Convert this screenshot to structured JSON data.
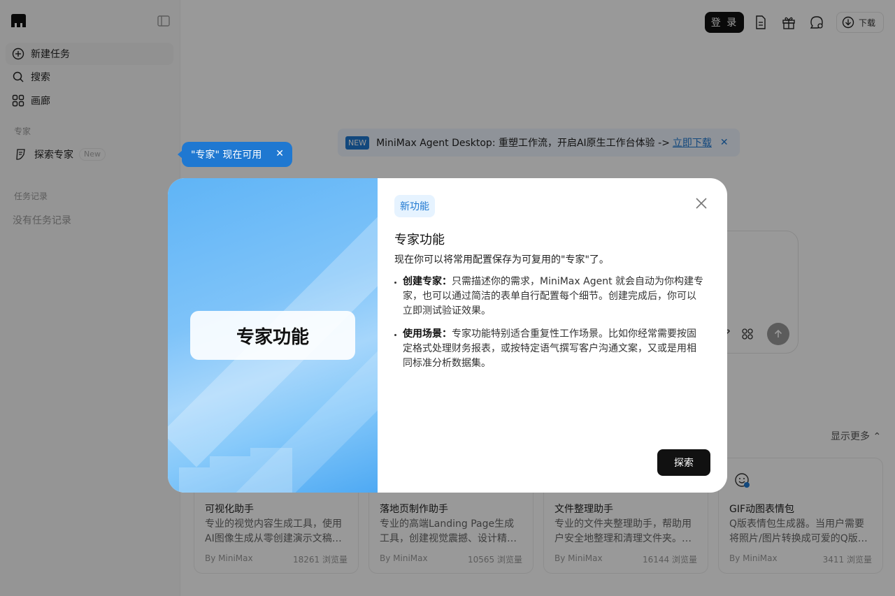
{
  "sidebar": {
    "nav": [
      {
        "label": "新建任务",
        "icon": "plus-circle-icon"
      },
      {
        "label": "搜索",
        "icon": "search-icon"
      },
      {
        "label": "画廊",
        "icon": "grid-icon"
      }
    ],
    "experts_section": "专家",
    "explore_experts": "探索专家",
    "new_badge": "New",
    "history_section": "任务记录",
    "no_history": "没有任务记录"
  },
  "tooltip": {
    "text": "\"专家\" 现在可用",
    "close": "✕"
  },
  "header": {
    "login": "登 录",
    "download": "下载"
  },
  "banner": {
    "badge": "NEW",
    "text": "MiniMax Agent Desktop: 重塑工作流，开启AI原生工作台体验 ->",
    "link": "立即下载",
    "close": "✕"
  },
  "show_more": "显示更多",
  "cards": [
    {
      "title": "可视化助手",
      "desc": "专业的视觉内容生成工具，使用AI图像生成从零创建演示文稿…",
      "by": "By MiniMax",
      "views": "18261 浏览量"
    },
    {
      "title": "落地页制作助手",
      "desc": "专业的高端Landing Page生成工具，创建视觉震撼、设计精…",
      "by": "By MiniMax",
      "views": "10565 浏览量"
    },
    {
      "title": "文件整理助手",
      "desc": "专业的文件夹整理助手，帮助用户安全地整理和清理文件夹。…",
      "by": "By MiniMax",
      "views": "16144 浏览量"
    },
    {
      "title": "GIF动图表情包",
      "desc": "Q版表情包生成器。当用户需要将照片/图片转换成可爱的Q版…",
      "by": "By MiniMax",
      "views": "3411 浏览量"
    }
  ],
  "modal": {
    "hero": "专家功能",
    "tag": "新功能",
    "title": "专家功能",
    "subtitle": "现在你可以将常用配置保存为可复用的\"专家\"了。",
    "items": [
      {
        "head": "创建专家：",
        "body": "只需描述你的需求，MiniMax Agent 就会自动为你构建专家，也可以通过简洁的表单自行配置每个细节。创建完成后，你可以立即测试验证效果。"
      },
      {
        "head": "使用场景：",
        "body": "专家功能特别适合重复性工作场景。比如你经常需要按固定格式处理财务报表，或按特定语气撰写客户沟通文案，又或是用相同标准分析数据集。"
      }
    ],
    "explore": "探索"
  }
}
